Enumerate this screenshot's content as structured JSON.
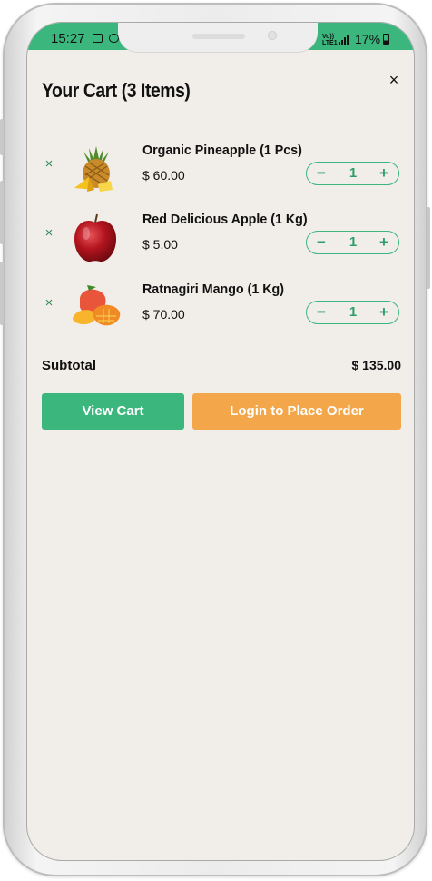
{
  "status_bar": {
    "time": "15:27",
    "network": "Vo)) LTE1",
    "battery": "17%",
    "icons": [
      "image-icon",
      "sync-icon",
      "signal-icon",
      "battery-icon"
    ]
  },
  "cart": {
    "title": "Your Cart (3 Items)",
    "close_label": "×",
    "items": [
      {
        "name": "Organic Pineapple (1 Pcs)",
        "price": "$ 60.00",
        "qty": "1",
        "remove": "×",
        "minus": "−",
        "plus": "+",
        "image": "pineapple-image"
      },
      {
        "name": "Red Delicious Apple (1 Kg)",
        "price": "$ 5.00",
        "qty": "1",
        "remove": "×",
        "minus": "−",
        "plus": "+",
        "image": "apple-image"
      },
      {
        "name": "Ratnagiri Mango (1 Kg)",
        "price": "$ 70.00",
        "qty": "1",
        "remove": "×",
        "minus": "−",
        "plus": "+",
        "image": "mango-image"
      }
    ],
    "subtotal_label": "Subtotal",
    "subtotal_value": "$ 135.00",
    "view_cart_label": "View Cart",
    "login_label": "Login to Place Order"
  },
  "colors": {
    "accent_green": "#3bb77e",
    "accent_orange": "#f3a74a",
    "background": "#f1ede8"
  }
}
